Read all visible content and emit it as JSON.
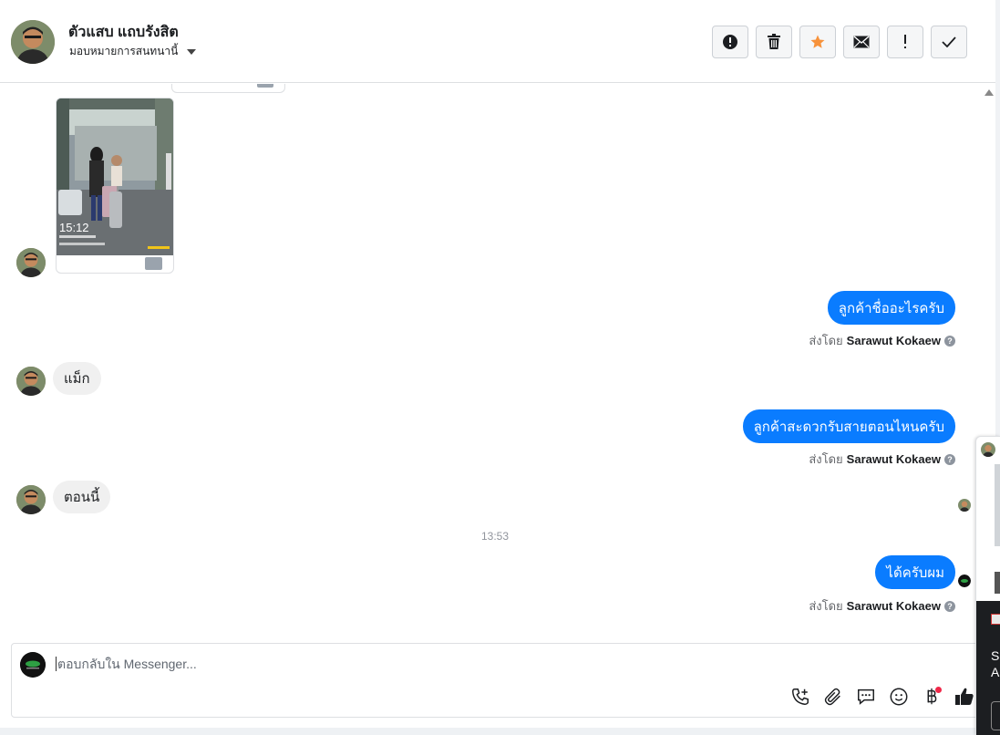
{
  "header": {
    "name": "ตัวแสบ แถบรังสิต",
    "assign_label": "มอบหมายการสนทนานี้"
  },
  "actions": [
    {
      "name": "report-button",
      "icon": "alert-circle-icon"
    },
    {
      "name": "delete-button",
      "icon": "trash-icon"
    },
    {
      "name": "star-button",
      "icon": "star-icon",
      "color": "#f7923b"
    },
    {
      "name": "mark-unread-button",
      "icon": "envelope-icon"
    },
    {
      "name": "important-button",
      "icon": "exclamation-icon"
    },
    {
      "name": "done-button",
      "icon": "check-icon"
    }
  ],
  "image_card": {
    "overlay_time": "15:12"
  },
  "messages": {
    "out1": "ลูกค้าชื่ออะไรครับ",
    "in1": "แม็ก",
    "out2": "ลูกค้าสะดวกรับสายตอนไหนครับ",
    "in2": "ตอนนี้",
    "timestamp": "13:53",
    "out3": "ได้ครับผม"
  },
  "sent_by": {
    "prefix": "ส่งโดย",
    "name": "Sarawut Kokaew",
    "help": "?"
  },
  "composer": {
    "placeholder": "ตอบกลับใน Messenger..."
  },
  "composer_tools": [
    "phone-plus-icon",
    "paperclip-icon",
    "chat-bubble-icon",
    "smiley-icon",
    "baht-icon",
    "thumbs-up-icon"
  ],
  "side_panel": {
    "line1": "S",
    "line2": "A"
  },
  "colors": {
    "outgoing_bubble": "#0a7cff",
    "incoming_bubble": "#f0f0f0",
    "star": "#f7923b"
  }
}
